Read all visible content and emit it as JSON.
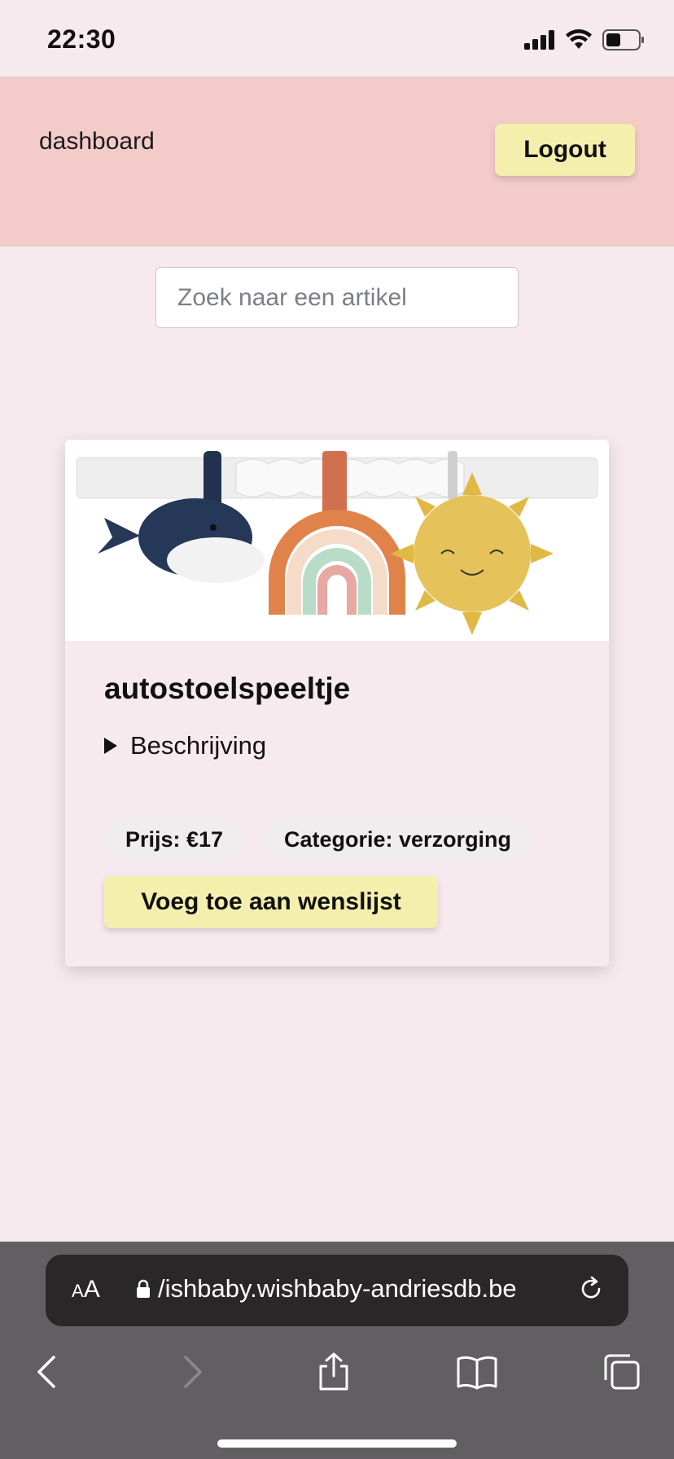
{
  "status_bar": {
    "time": "22:30",
    "battery_level": 0.45
  },
  "header": {
    "dashboard_link": "dashboard",
    "logout_label": "Logout"
  },
  "search": {
    "placeholder": "Zoek naar een artikel"
  },
  "product": {
    "title": "autostoelspeeltje",
    "description_toggle": "Beschrijving",
    "price_label": "Prijs: €17",
    "category_label": "Categorie: verzorging",
    "wishlist_button": "Voeg toe aan wenslijst",
    "image_icon": "baby-toy-image"
  },
  "browser": {
    "aa_label_small": "A",
    "aa_label_large": "A",
    "url": "/ishbaby.wishbaby-andriesdb.be",
    "icons": [
      "back-icon",
      "forward-icon",
      "share-icon",
      "bookmarks-icon",
      "tabs-icon",
      "reload-icon",
      "lock-icon"
    ]
  },
  "colors": {
    "background": "#f7eaee",
    "header": "#f3cbc9",
    "button": "#f4efad",
    "browser_bar": "#625f63"
  }
}
